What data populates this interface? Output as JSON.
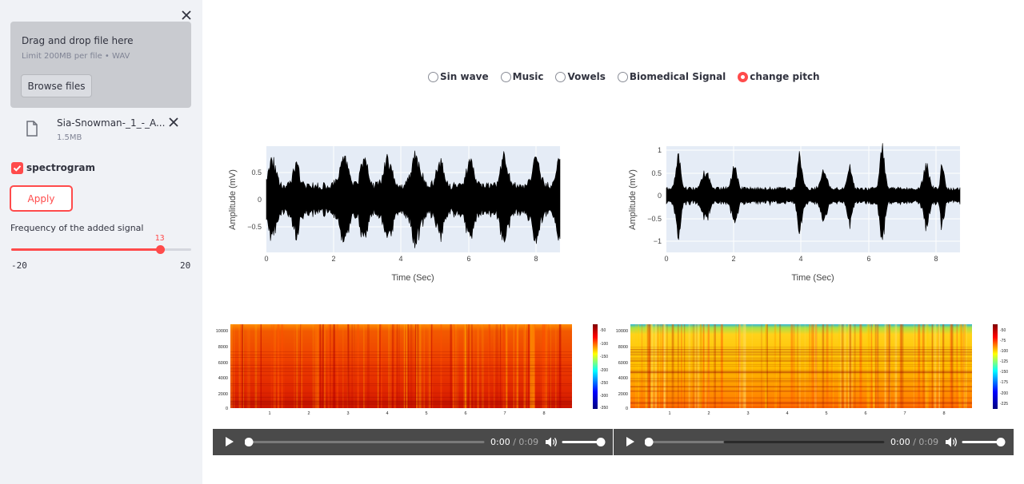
{
  "sidebar": {
    "uploader": {
      "title": "Drag and drop file here",
      "limit_text": "Limit 200MB per file • WAV",
      "browse_label": "Browse files"
    },
    "file": {
      "name": "Sia-Snowman-_1_-_A...",
      "size": "1.5MB"
    },
    "spectrogram_checkbox": {
      "label": "spectrogram",
      "checked": true
    },
    "apply_label": "Apply",
    "slider": {
      "label": "Frequency of the added signal",
      "min": -20,
      "max": 20,
      "value": 13,
      "min_text": "-20",
      "max_text": "20",
      "value_text": "13"
    }
  },
  "signal_type": {
    "options": [
      "Sin wave",
      "Music",
      "Vowels",
      "Biomedical Signal",
      "change pitch"
    ],
    "selected": "change pitch"
  },
  "plots": [
    {
      "xlabel": "Time (Sec)",
      "ylabel": "Amplitude (mV)",
      "x_ticks": [
        "0",
        "2",
        "4",
        "6",
        "8"
      ],
      "y_ticks": [
        "0.5",
        "0",
        "−0.5"
      ]
    },
    {
      "xlabel": "Time (Sec)",
      "ylabel": "Amplitude (mV)",
      "x_ticks": [
        "0",
        "2",
        "4",
        "6",
        "8"
      ],
      "y_ticks": [
        "1",
        "0.5",
        "0",
        "−0.5",
        "−1"
      ]
    }
  ],
  "spectrograms": [
    {
      "y_ticks": [
        "10000",
        "8000",
        "6000",
        "4000",
        "2000",
        "0"
      ],
      "x_ticks": [
        "1",
        "2",
        "3",
        "4",
        "5",
        "6",
        "7",
        "8"
      ],
      "colorbar_ticks": [
        "-50",
        "-100",
        "-150",
        "-200",
        "-250",
        "-300",
        "-350"
      ]
    },
    {
      "y_ticks": [
        "10000",
        "8000",
        "6000",
        "4000",
        "2000",
        "0"
      ],
      "x_ticks": [
        "1",
        "2",
        "3",
        "4",
        "5",
        "6",
        "7",
        "8"
      ],
      "colorbar_ticks": [
        "-50",
        "-75",
        "-100",
        "-125",
        "-150",
        "-175",
        "-200",
        "-225"
      ]
    }
  ],
  "players": [
    {
      "current": "0:00",
      "duration": "/ 0:09"
    },
    {
      "current": "0:00",
      "duration": "/ 0:09"
    }
  ],
  "colors": {
    "accent": "#ff4b4b",
    "sidebar_bg": "#f0f2f6",
    "player_bg": "#4a4a4a",
    "plot_bg": "#e5ecf6"
  }
}
